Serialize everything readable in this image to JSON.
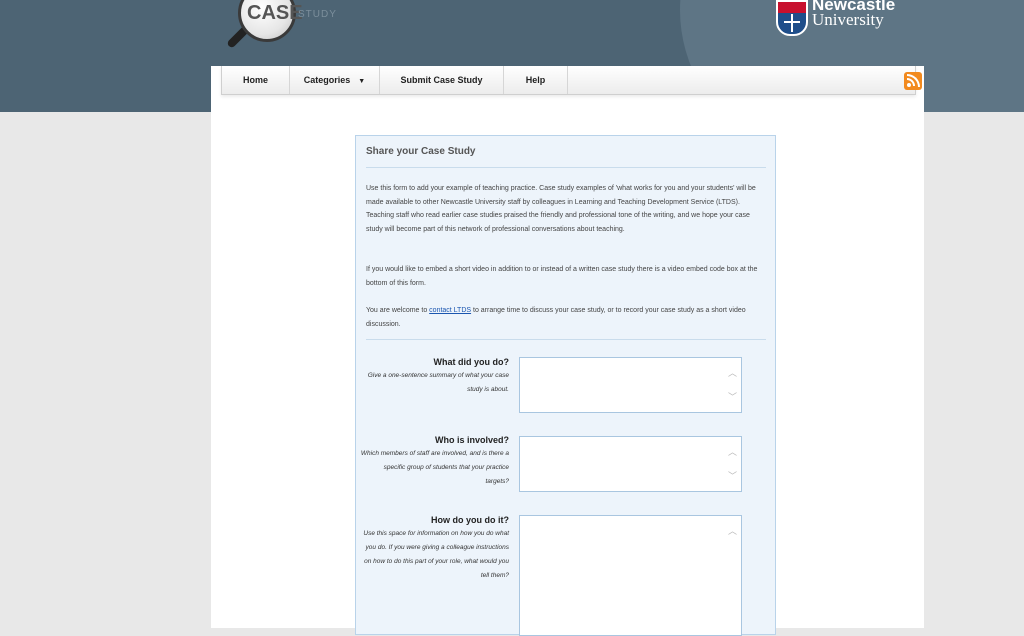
{
  "header": {
    "logo_main": "CASE",
    "logo_sub": "STUDY",
    "university_line1": "Newcastle",
    "university_line2": "University"
  },
  "nav": {
    "items": [
      {
        "label": "Home"
      },
      {
        "label": "Categories"
      },
      {
        "label": "Submit Case Study"
      },
      {
        "label": "Help"
      }
    ]
  },
  "form": {
    "title": "Share your Case Study",
    "intro1": "Use this form to add your example of teaching practice. Case study examples of 'what works for you and your students' will be made available to other Newcastle University staff by colleagues in Learning and Teaching Development Service (LTDS). Teaching staff who read earlier case studies praised the friendly and professional tone of the writing, and we hope your case study will become part of this network of professional conversations about teaching.",
    "intro2": "If you would like to embed a short video in addition to or instead of a written case study there is a video embed code box at the bottom of this form.",
    "intro3_before": "You are welcome to ",
    "intro3_link": "contact LTDS",
    "intro3_after": " to arrange time to discuss your case study, or to record your case study as a short video discussion.",
    "questions": [
      {
        "title": "What did you do?",
        "help": "Give a one-sentence summary of what your case study is about.",
        "value": ""
      },
      {
        "title": "Who is involved?",
        "help": "Which members of staff are involved, and is there a specific group of students that your practice targets?",
        "value": ""
      },
      {
        "title": "How do you do it?",
        "help": "Use this space for information on how you do what you do. If you were giving a colleague instructions on how to do this part of your role, what would you tell them?",
        "value": ""
      }
    ]
  },
  "colors": {
    "header_bg": "#4d6474",
    "form_bg": "#edf4fb",
    "rss": "#f28a1e",
    "link": "#1b56b0"
  }
}
